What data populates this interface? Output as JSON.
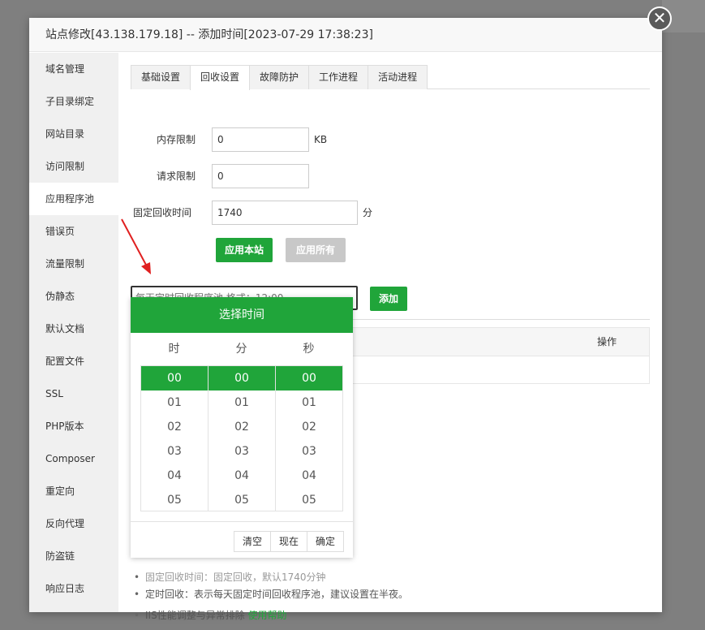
{
  "dialog": {
    "title": "站点修改[43.138.179.18] -- 添加时间[2023-07-29 17:38:23]",
    "close_label": "✕"
  },
  "sidebar": {
    "items": [
      {
        "label": "域名管理"
      },
      {
        "label": "子目录绑定"
      },
      {
        "label": "网站目录"
      },
      {
        "label": "访问限制"
      },
      {
        "label": "应用程序池",
        "active": true
      },
      {
        "label": "错误页"
      },
      {
        "label": "流量限制"
      },
      {
        "label": "伪静态"
      },
      {
        "label": "默认文档"
      },
      {
        "label": "配置文件"
      },
      {
        "label": "SSL"
      },
      {
        "label": "PHP版本"
      },
      {
        "label": "Composer"
      },
      {
        "label": "重定向"
      },
      {
        "label": "反向代理"
      },
      {
        "label": "防盗链"
      },
      {
        "label": "响应日志"
      }
    ]
  },
  "tabs": [
    {
      "label": "基础设置"
    },
    {
      "label": "回收设置",
      "active": true
    },
    {
      "label": "故障防护"
    },
    {
      "label": "工作进程"
    },
    {
      "label": "活动进程"
    }
  ],
  "form": {
    "memory_label": "内存限制",
    "memory_value": "0",
    "memory_unit": "KB",
    "request_label": "请求限制",
    "request_value": "0",
    "fixed_label": "固定回收时间",
    "fixed_value": "1740",
    "fixed_unit": "分",
    "apply_site": "应用本站",
    "apply_all": "应用所有"
  },
  "schedule": {
    "placeholder": "每天定时回收程序池,格式：12:00",
    "add_label": "添加",
    "col_op": "操作"
  },
  "picker": {
    "title": "选择时间",
    "col_hour": "时",
    "col_min": "分",
    "col_sec": "秒",
    "hours": [
      "00",
      "01",
      "02",
      "03",
      "04",
      "05"
    ],
    "minutes": [
      "00",
      "01",
      "02",
      "03",
      "04",
      "05"
    ],
    "seconds": [
      "00",
      "01",
      "02",
      "03",
      "04",
      "05"
    ],
    "clear": "清空",
    "now": "现在",
    "ok": "确定"
  },
  "notes": {
    "partial": "固定回收时间：固定回收，默认1740分钟",
    "n2": "定时回收：表示每天固定时间回收程序池，建议设置在半夜。",
    "n3": "IIS性能调整与异常排除",
    "n3_link": "使用帮助"
  },
  "colors": {
    "accent": "#20a53a",
    "arrow": "#e02020"
  }
}
